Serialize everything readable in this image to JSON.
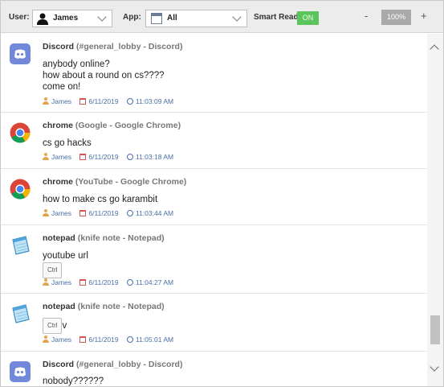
{
  "toolbar": {
    "user_label": "User:",
    "user_value": "James",
    "app_label": "App:",
    "app_value": "All",
    "smart_read_label": "Smart Read",
    "smart_read_state": "ON",
    "zoom_minus": "-",
    "zoom_value": "100%",
    "zoom_plus": "+"
  },
  "messages": [
    {
      "app": "Discord",
      "context": "(#general_lobby - Discord)",
      "lines": [
        "anybody online?",
        "how about a round on cs????",
        "come on!"
      ],
      "user": "James",
      "date": "6/11/2019",
      "time": "11:03:09 AM"
    },
    {
      "app": "chrome",
      "context": "(Google - Google Chrome)",
      "lines": [
        "cs go hacks"
      ],
      "user": "James",
      "date": "6/11/2019",
      "time": "11:03:18 AM"
    },
    {
      "app": "chrome",
      "context": "(YouTube - Google Chrome)",
      "lines": [
        "how to make cs go karambit"
      ],
      "user": "James",
      "date": "6/11/2019",
      "time": "11:03:44 AM"
    },
    {
      "app": "notepad",
      "context": "(knife note - Notepad)",
      "lines": [
        "youtube url"
      ],
      "key": "Ctrl",
      "user": "James",
      "date": "6/11/2019",
      "time": "11:04:27 AM"
    },
    {
      "app": "notepad",
      "context": "(knife note - Notepad)",
      "key": "Ctrl",
      "after_key": "v",
      "user": "James",
      "date": "6/11/2019",
      "time": "11:05:01 AM"
    },
    {
      "app": "Discord",
      "context": "(#general_lobby - Discord)",
      "lines": [
        "nobody??????"
      ]
    }
  ],
  "colors": {
    "toggle_on": "#5cc45c",
    "meta_text": "#4a6fa5",
    "discord": "#7289da"
  }
}
